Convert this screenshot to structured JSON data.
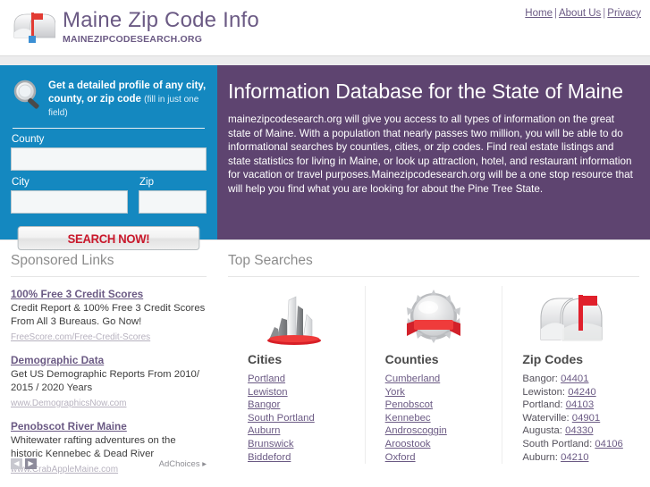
{
  "header": {
    "logo_icon": "mailbox-icon",
    "title": "Maine Zip Code Info",
    "subtitle": "MAINEZIPCODESEARCH.ORG",
    "nav": [
      {
        "label": "Home"
      },
      {
        "label": "About Us"
      },
      {
        "label": "Privacy"
      }
    ],
    "nav_separator": "|"
  },
  "search_panel": {
    "icon": "magnifier-icon",
    "headline": "Get a detailed profile of any city, county, or zip code",
    "hint": "(fill in just one field)",
    "fields": {
      "county_label": "County",
      "county_value": "",
      "city_label": "City",
      "city_value": "",
      "zip_label": "Zip",
      "zip_value": ""
    },
    "button_label": "SEARCH NOW!",
    "bg_color": "#1488c0",
    "button_text_color": "#c9182b"
  },
  "hero": {
    "title": "Information Database for the State of Maine",
    "body": "mainezipcodesearch.org will give you access to all types of information on the great state of Maine. With a population that nearly passes two million, you will be able to do informational searches by counties, cities, or zip codes. Find real estate listings and state statistics for living in Maine, or look up attraction, hotel, and restaurant information for vacation or travel purposes.Mainezipcodesearch.org will be a one stop resource that will help you find what you are looking for about the Pine Tree State.",
    "bg_color": "#5e4470"
  },
  "sponsored": {
    "title": "Sponsored Links",
    "ads": [
      {
        "title": "100% Free 3 Credit Scores",
        "desc": "Credit Report & 100% Free 3 Credit Scores From All 3 Bureaus. Go Now!",
        "url": "FreeScore.com/Free-Credit-Scores"
      },
      {
        "title": "Demographic Data",
        "desc": "Get US Demographic Reports From 2010/ 2015 / 2020 Years",
        "url": "www.DemographicsNow.com"
      },
      {
        "title": "Penobscot River Maine",
        "desc": "Whitewater rafting adventures on the historic Kennebec & Dead River",
        "url": "www.CrabAppleMaine.com"
      }
    ],
    "prev_arrow": "◀",
    "next_arrow": "▶",
    "adchoices_label": "AdChoices",
    "adchoices_icon": "adchoices-icon"
  },
  "top_searches": {
    "title": "Top Searches",
    "columns": [
      {
        "icon": "city-skyline-icon",
        "title": "Cities",
        "items": [
          {
            "label": "Portland"
          },
          {
            "label": "Lewiston"
          },
          {
            "label": "Bangor"
          },
          {
            "label": "South Portland"
          },
          {
            "label": "Auburn"
          },
          {
            "label": "Brunswick"
          },
          {
            "label": "Biddeford"
          }
        ]
      },
      {
        "icon": "county-seal-icon",
        "title": "Counties",
        "items": [
          {
            "label": "Cumberland"
          },
          {
            "label": "York"
          },
          {
            "label": "Penobscot"
          },
          {
            "label": "Kennebec"
          },
          {
            "label": "Androscoggin"
          },
          {
            "label": "Aroostook"
          },
          {
            "label": "Oxford"
          }
        ]
      },
      {
        "icon": "mailbox-icon",
        "title": "Zip Codes",
        "items": [
          {
            "city": "Bangor:",
            "zip": "04401"
          },
          {
            "city": "Lewiston:",
            "zip": "04240"
          },
          {
            "city": "Portland:",
            "zip": "04103"
          },
          {
            "city": "Waterville:",
            "zip": "04901"
          },
          {
            "city": "Augusta:",
            "zip": "04330"
          },
          {
            "city": "South Portland:",
            "zip": "04106"
          },
          {
            "city": "Auburn:",
            "zip": "04210"
          }
        ]
      }
    ]
  }
}
